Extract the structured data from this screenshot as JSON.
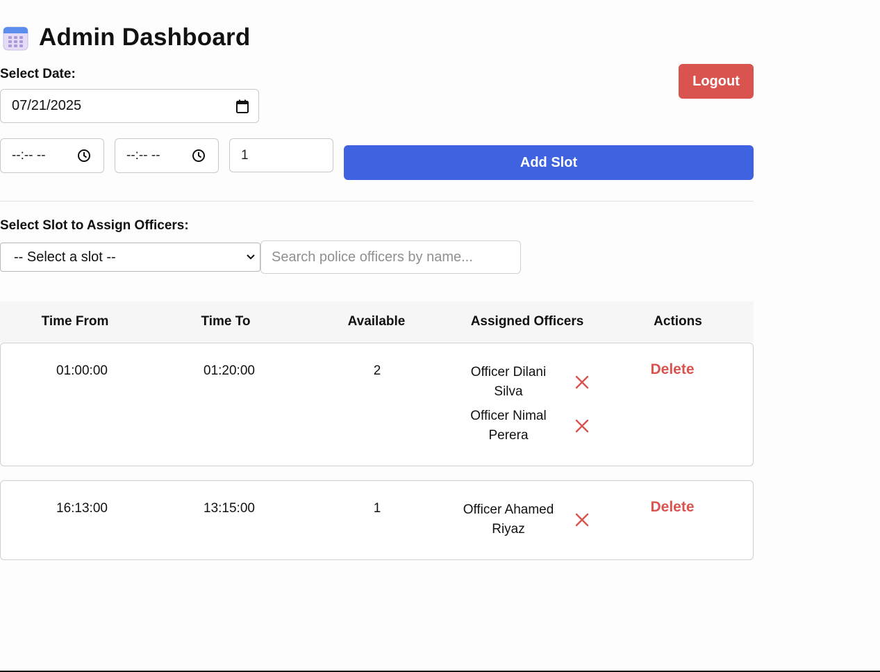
{
  "header": {
    "title": "Admin Dashboard",
    "icon": "calendar-icon"
  },
  "logout_label": "Logout",
  "date_section": {
    "label": "Select Date:",
    "value": "07/21/2025"
  },
  "slot_form": {
    "time_from_value": "--:-- --",
    "time_to_value": "--:-- --",
    "capacity_value": "1",
    "add_slot_label": "Add Slot"
  },
  "assign_section": {
    "label": "Select Slot to Assign Officers:",
    "select_value": "-- Select a slot --",
    "search_placeholder": "Search police officers by name..."
  },
  "table": {
    "headers": [
      "Time From",
      "Time To",
      "Available",
      "Assigned Officers",
      "Actions"
    ],
    "rows": [
      {
        "time_from": "01:00:00",
        "time_to": "01:20:00",
        "available": "2",
        "officers": [
          {
            "line1": "Officer Dilani",
            "line2": "Silva"
          },
          {
            "line1": "Officer Nimal",
            "line2": "Perera"
          }
        ],
        "action": "Delete"
      },
      {
        "time_from": "16:13:00",
        "time_to": "13:15:00",
        "available": "1",
        "officers": [
          {
            "line1": "Officer Ahamed",
            "line2": "Riyaz"
          }
        ],
        "action": "Delete"
      }
    ]
  },
  "colors": {
    "primary": "#3f63e0",
    "danger": "#d9534f",
    "header_bg": "#f7f6f6"
  }
}
